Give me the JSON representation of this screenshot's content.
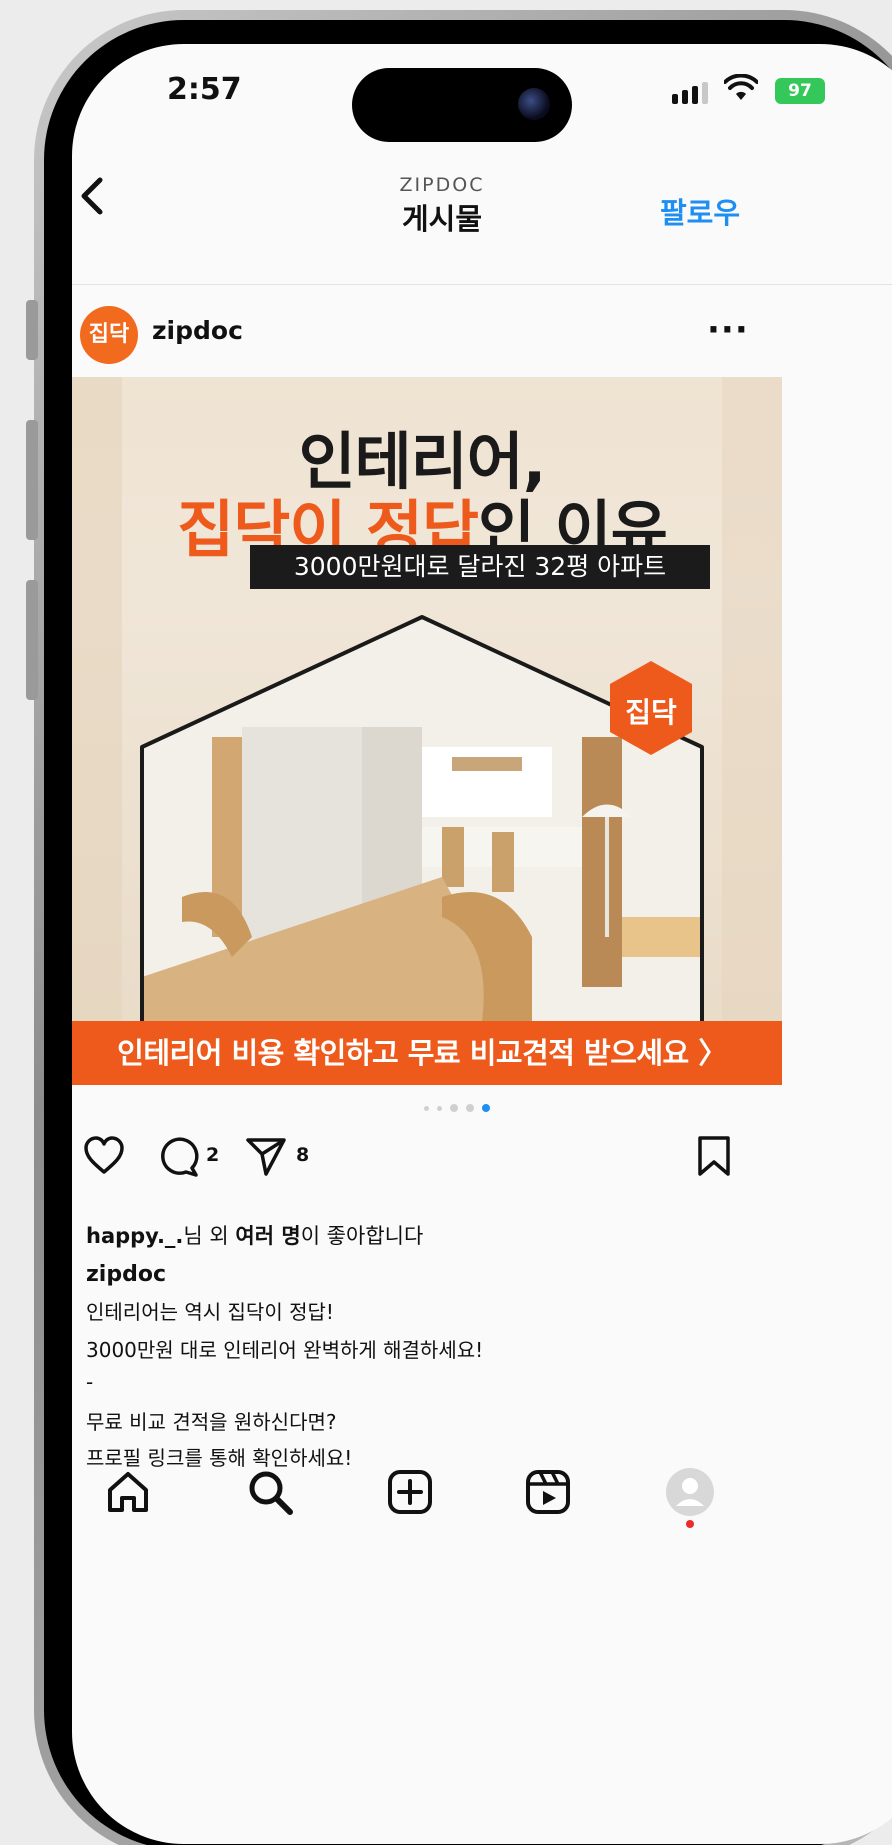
{
  "status_bar": {
    "time": "2:57",
    "battery": "97"
  },
  "header": {
    "subtitle": "ZIPDOC",
    "title": "게시물",
    "follow_label": "팔로우"
  },
  "post": {
    "avatar_text": "집닥",
    "username": "zipdoc",
    "more": "···",
    "image": {
      "headline_line1": "인테리어,",
      "headline_accent": "집닥이 정답",
      "headline_rest": "인 이유",
      "sub_banner": "3000만원대로 달라진 32평 아파트",
      "badge_text": "집닥",
      "cta": "인테리어 비용 확인하고 무료 비교견적 받으세요  〉"
    },
    "carousel": {
      "count": 5,
      "active_index": 4
    },
    "comment_count": "2",
    "share_count": "8",
    "likes": {
      "user": "happy._.",
      "middle": "님 외 ",
      "bold": "여러 명",
      "tail": "이 좋아합니다"
    },
    "caption_user": "zipdoc",
    "caption_lines": [
      "인테리어는 역시 집닥이 정답!",
      "3000만원 대로 인테리어 완벽하게 해결하세요!",
      "-",
      "무료 비교 견적을 원하신다면?",
      "프로필 링크를 통해 확인하세요!"
    ]
  },
  "colors": {
    "brand_orange": "#ee5a1b",
    "follow_blue": "#1d8ff3"
  },
  "icons": [
    "back-icon",
    "more-icon",
    "heart-icon",
    "comment-icon",
    "share-icon",
    "bookmark-icon",
    "home-icon",
    "search-icon",
    "add-icon",
    "reels-icon",
    "profile-icon"
  ]
}
